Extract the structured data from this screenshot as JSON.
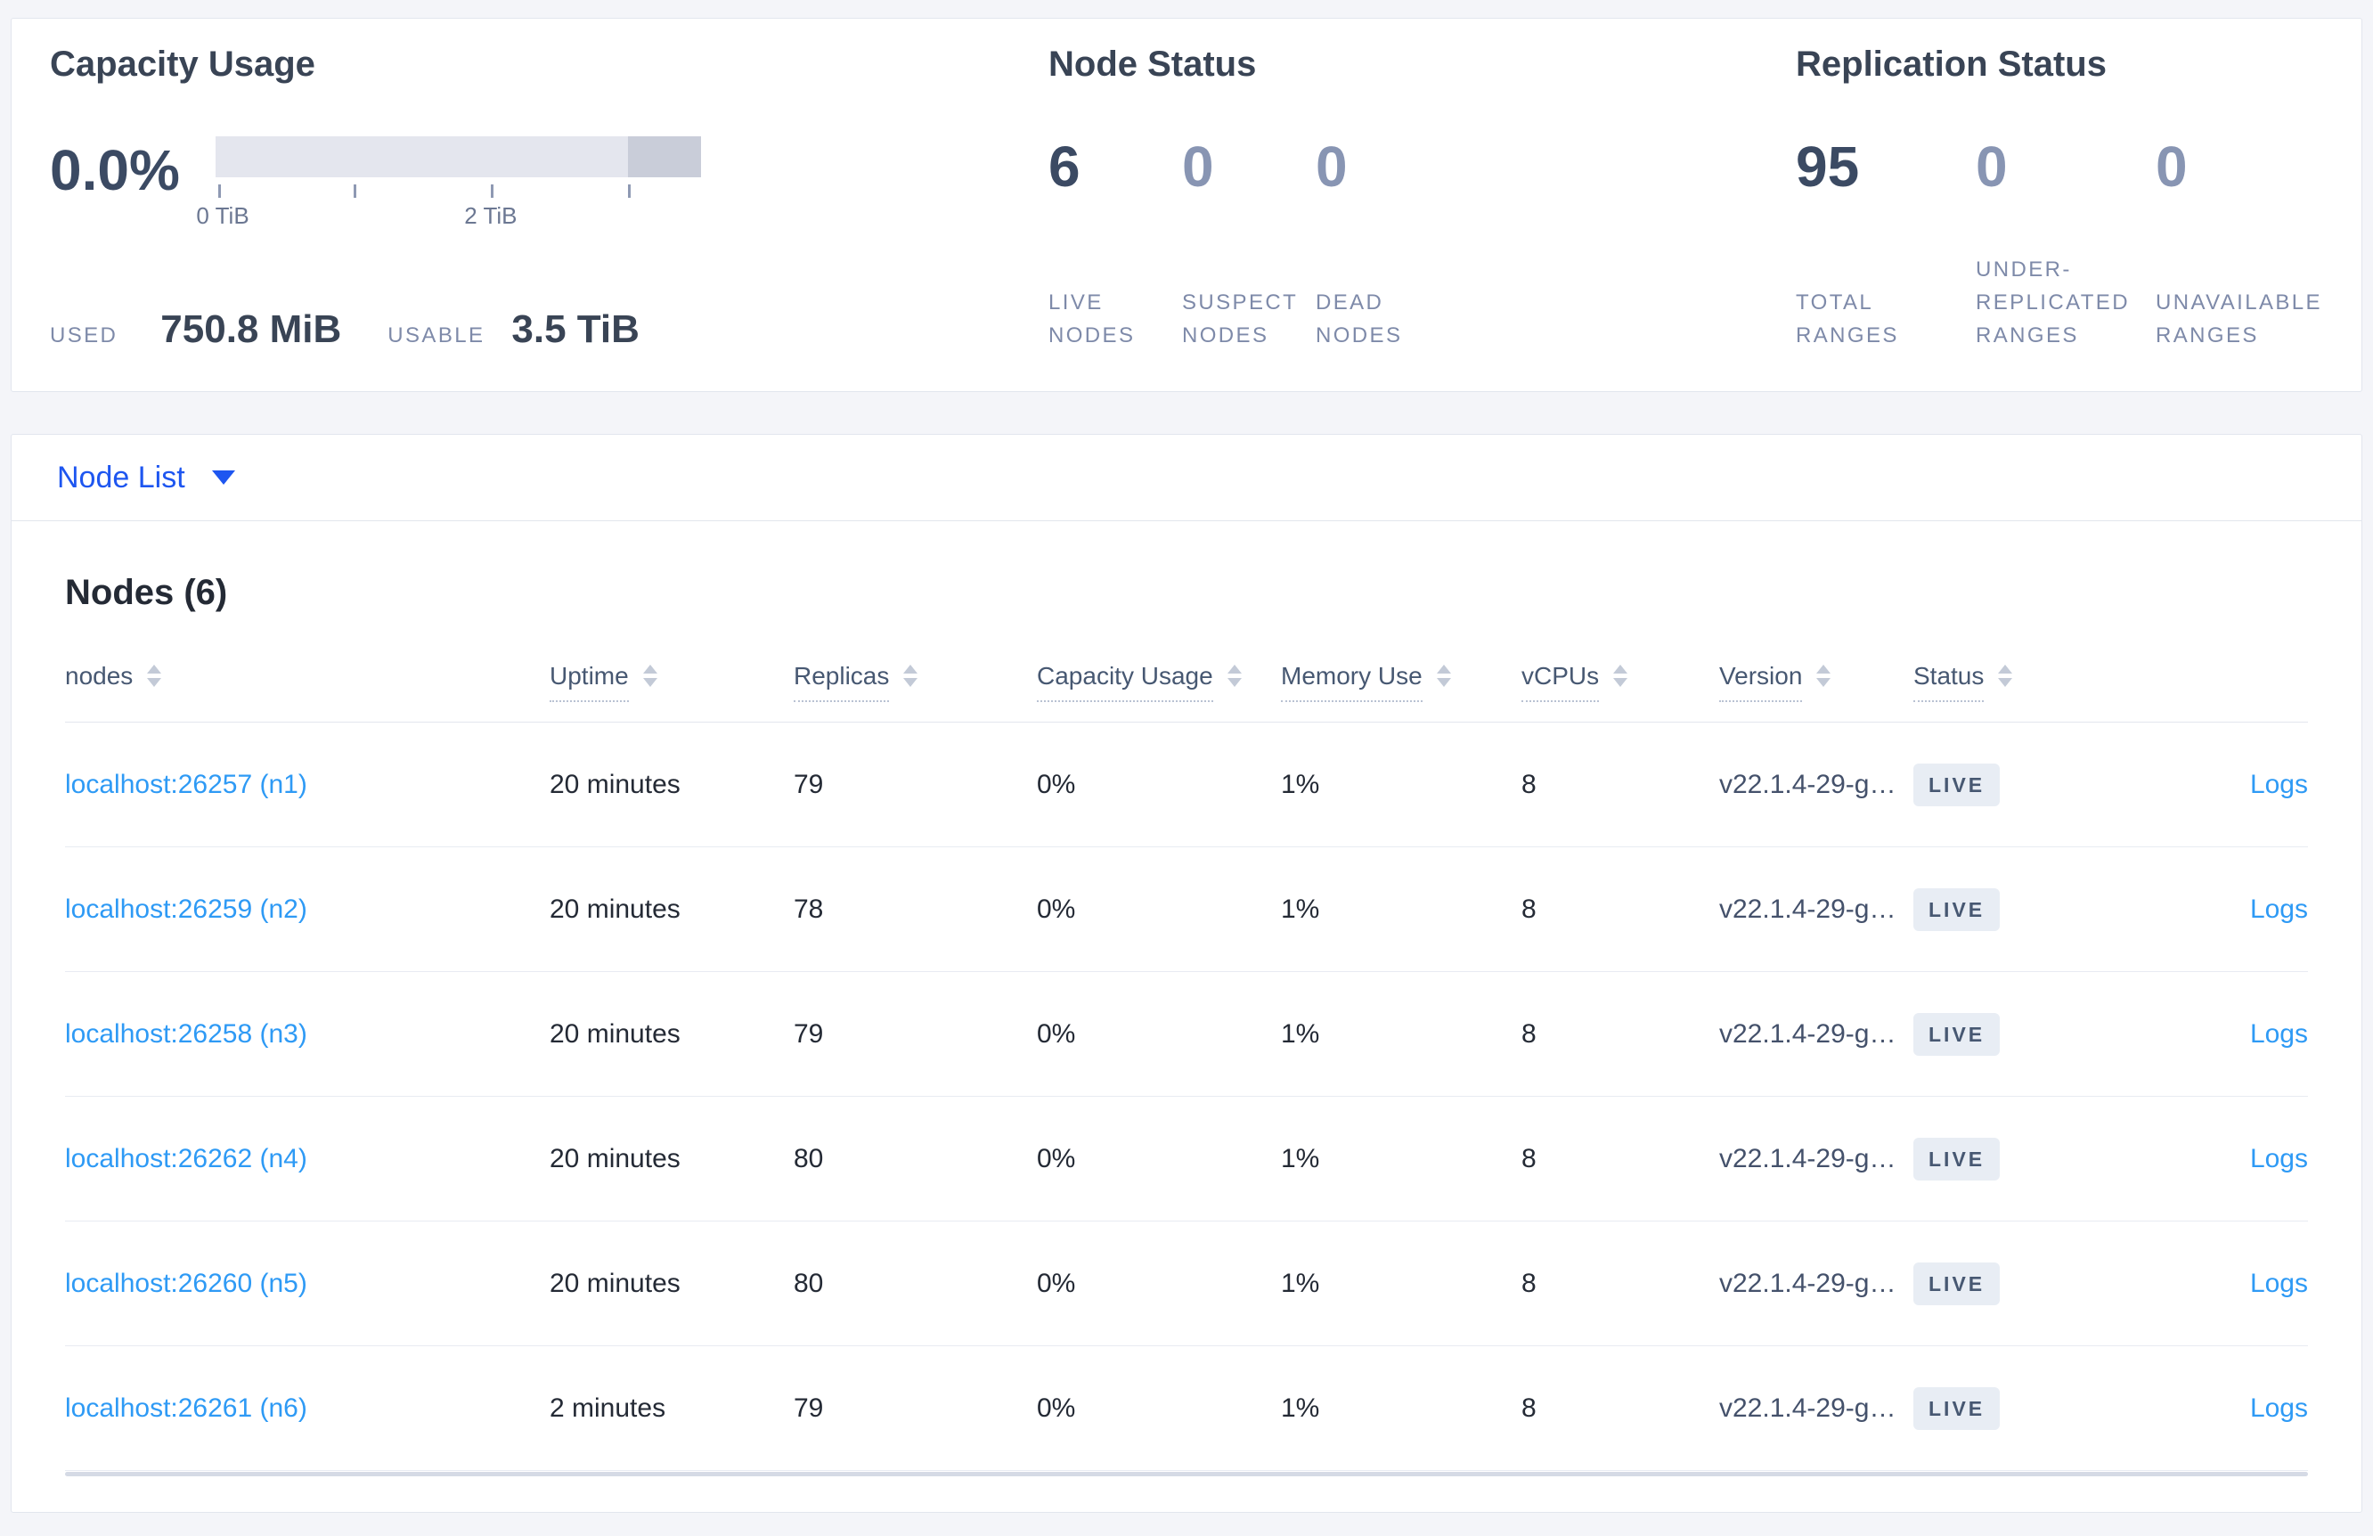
{
  "summary": {
    "capacity": {
      "title": "Capacity Usage",
      "percent": "0.0%",
      "tick_labels": [
        "0 TiB",
        "2 TiB"
      ],
      "used_label": "USED",
      "used_value": "750.8 MiB",
      "usable_label": "USABLE",
      "usable_value": "3.5 TiB"
    },
    "node_status": {
      "title": "Node Status",
      "stats": [
        {
          "value": "6",
          "label": "LIVE NODES"
        },
        {
          "value": "0",
          "label": "SUSPECT NODES"
        },
        {
          "value": "0",
          "label": "DEAD NODES"
        }
      ]
    },
    "replication": {
      "title": "Replication Status",
      "stats": [
        {
          "value": "95",
          "label": "TOTAL RANGES"
        },
        {
          "value": "0",
          "label": "UNDER-REPLICATED RANGES"
        },
        {
          "value": "0",
          "label": "UNAVAILABLE RANGES"
        }
      ]
    }
  },
  "node_list": {
    "label": "Node List"
  },
  "nodes": {
    "title": "Nodes (6)",
    "columns": [
      "nodes",
      "Uptime",
      "Replicas",
      "Capacity Usage",
      "Memory Use",
      "vCPUs",
      "Version",
      "Status"
    ],
    "rows": [
      {
        "address": "localhost:26257 (n1)",
        "uptime": "20 minutes",
        "replicas": "79",
        "capacity": "0%",
        "memory": "1%",
        "vcpus": "8",
        "version": "v22.1.4-29-g…",
        "status": "LIVE",
        "logs": "Logs"
      },
      {
        "address": "localhost:26259 (n2)",
        "uptime": "20 minutes",
        "replicas": "78",
        "capacity": "0%",
        "memory": "1%",
        "vcpus": "8",
        "version": "v22.1.4-29-g…",
        "status": "LIVE",
        "logs": "Logs"
      },
      {
        "address": "localhost:26258 (n3)",
        "uptime": "20 minutes",
        "replicas": "79",
        "capacity": "0%",
        "memory": "1%",
        "vcpus": "8",
        "version": "v22.1.4-29-g…",
        "status": "LIVE",
        "logs": "Logs"
      },
      {
        "address": "localhost:26262 (n4)",
        "uptime": "20 minutes",
        "replicas": "80",
        "capacity": "0%",
        "memory": "1%",
        "vcpus": "8",
        "version": "v22.1.4-29-g…",
        "status": "LIVE",
        "logs": "Logs"
      },
      {
        "address": "localhost:26260 (n5)",
        "uptime": "20 minutes",
        "replicas": "80",
        "capacity": "0%",
        "memory": "1%",
        "vcpus": "8",
        "version": "v22.1.4-29-g…",
        "status": "LIVE",
        "logs": "Logs"
      },
      {
        "address": "localhost:26261 (n6)",
        "uptime": "2 minutes",
        "replicas": "79",
        "capacity": "0%",
        "memory": "1%",
        "vcpus": "8",
        "version": "v22.1.4-29-g…",
        "status": "LIVE",
        "logs": "Logs"
      }
    ]
  },
  "colors": {
    "link_blue": "#2e9af5",
    "primary_blue": "#1e56f0",
    "dark_slate": "#394455",
    "muted_slate": "#8895b3",
    "label_gray": "#7e8aa9",
    "badge_bg": "#e8edf4",
    "page_bg": "#f4f5f9"
  }
}
